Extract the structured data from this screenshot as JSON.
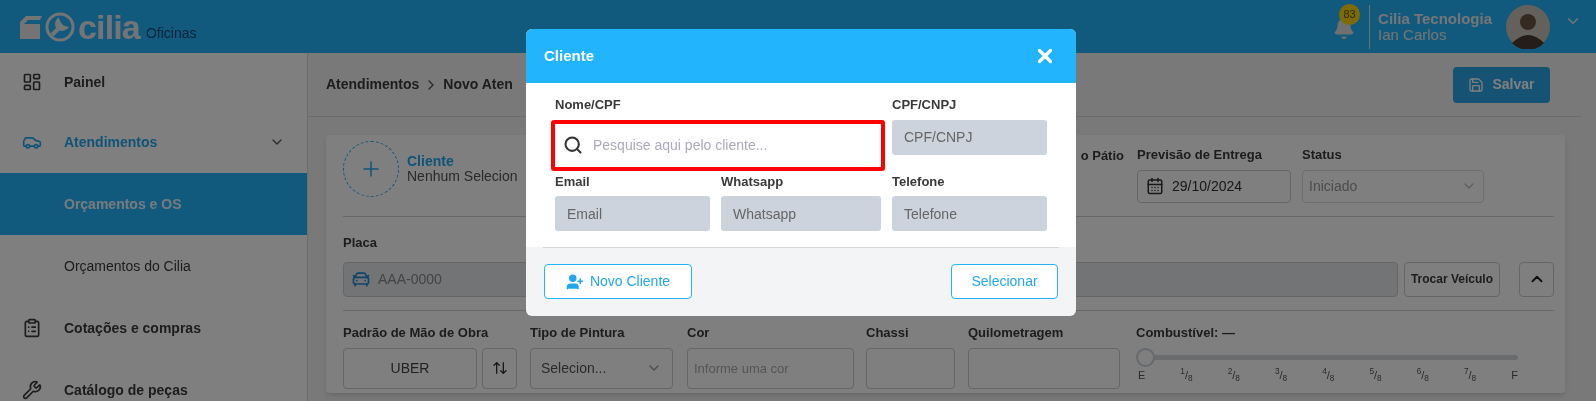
{
  "header": {
    "logo_text": "cilia",
    "logo_subtitle": "Oficinas",
    "notifications": "83",
    "company": "Cilia Tecnologia",
    "user": "Ian Carlos"
  },
  "sidebar": {
    "items": [
      {
        "label": "Painel",
        "selected": false
      },
      {
        "label": "Atendimentos",
        "selected": true,
        "expanded": true,
        "children": [
          {
            "label": "Orçamentos e OS",
            "selected": true
          },
          {
            "label": "Orçamentos do Cilia",
            "selected": false
          }
        ]
      },
      {
        "label": "Cotações e compras",
        "selected": false
      },
      {
        "label": "Catálogo de peças",
        "selected": false
      }
    ]
  },
  "breadcrumb": [
    "Atendimentos",
    "Novo Aten"
  ],
  "save_button": "Salvar",
  "form": {
    "client": {
      "label": "Cliente",
      "value": "Nenhum Selecion"
    },
    "column_1_label": "o Pátio",
    "delivery": {
      "label": "Previsão de Entrega",
      "value": "29/10/2024"
    },
    "status": {
      "label": "Status",
      "value": "Iniciado",
      "disabled": true
    },
    "plate": {
      "label": "Placa",
      "placeholder": "AAA-0000"
    },
    "change_vehicle_button": "Trocar Veículo",
    "labor": {
      "label": "Padrão de Mão de Obra",
      "value": "UBER"
    },
    "paint": {
      "label": "Tipo de Pintura",
      "value": "Selecion..."
    },
    "color": {
      "label": "Cor",
      "placeholder": "Informe uma cor"
    },
    "chassis": {
      "label": "Chassi"
    },
    "mileage": {
      "label": "Quilometragem"
    },
    "fuel": {
      "label": "Combustível: —",
      "level": 0,
      "ticks": [
        "E",
        "$^{1}$/$_{8}$",
        "$^{2}$/$_{8}$",
        "$^{3}$/$_{8}$",
        "$^{4}$/$_{8}$",
        "$^{5}$/$_{8}$",
        "$^{6}$/$_{8}$",
        "$^{7}$/$_{8}$",
        "F"
      ]
    }
  },
  "modal": {
    "title": "Cliente",
    "fields": [
      {
        "label": "Nome/CPF",
        "placeholder": "Pesquise aqui pelo cliente...",
        "kind": "search",
        "disabled": false
      },
      {
        "label": "CPF/CNPJ",
        "placeholder": "CPF/CNPJ",
        "kind": "text",
        "disabled": true
      },
      {
        "label": "Email",
        "placeholder": "Email",
        "kind": "text",
        "disabled": true
      },
      {
        "label": "Whatsapp",
        "placeholder": "Whatsapp",
        "kind": "text",
        "disabled": true
      },
      {
        "label": "Telefone",
        "placeholder": "Telefone",
        "kind": "text",
        "disabled": true
      }
    ],
    "new_client_button": "Novo Cliente",
    "select_button": "Selecionar"
  }
}
